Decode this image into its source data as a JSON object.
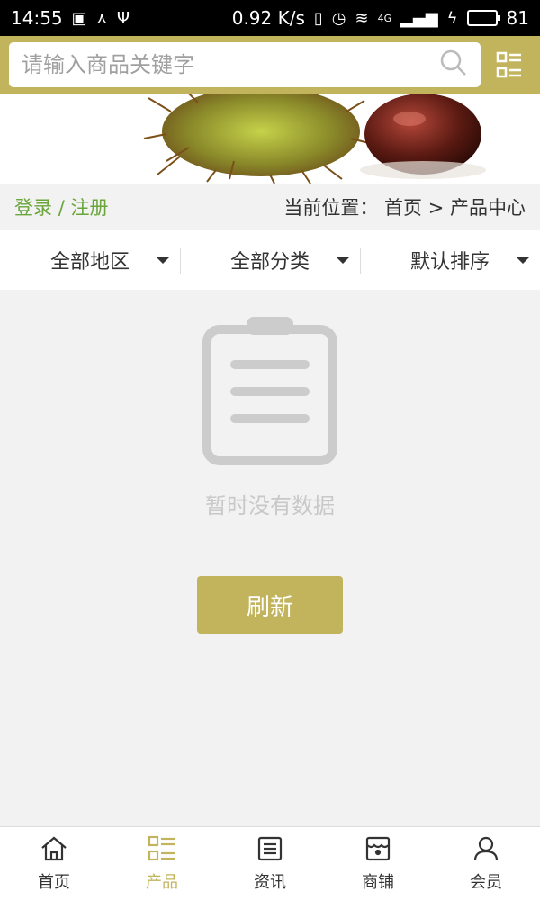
{
  "status": {
    "time": "14:55",
    "speed": "0.92 K/s",
    "network": "4G",
    "battery": "81",
    "battery_level": 0.81,
    "battery_color": "#3fd13f"
  },
  "search": {
    "placeholder": "请输入商品关键字",
    "icon": "search-icon"
  },
  "header": {
    "accent": "#c2b45c",
    "menu_icon": "grid-list-icon"
  },
  "auth": {
    "login": "登录",
    "separator": "/",
    "register": "注册",
    "color": "#6aa63b"
  },
  "breadcrumb": {
    "label": "当前位置：",
    "home": "首页",
    "separator": ">",
    "current": "产品中心"
  },
  "filters": [
    {
      "label": "全部地区",
      "icon": "caret-down-icon"
    },
    {
      "label": "全部分类",
      "icon": "caret-down-icon"
    },
    {
      "label": "默认排序",
      "icon": "caret-down-icon"
    }
  ],
  "empty": {
    "icon": "clipboard-icon",
    "text": "暂时没有数据",
    "button": "刷新"
  },
  "tabs": [
    {
      "label": "首页",
      "icon": "home-icon",
      "active": false
    },
    {
      "label": "产品",
      "icon": "product-list-icon",
      "active": true
    },
    {
      "label": "资讯",
      "icon": "news-icon",
      "active": false
    },
    {
      "label": "商铺",
      "icon": "shop-icon",
      "active": false
    },
    {
      "label": "会员",
      "icon": "user-icon",
      "active": false
    }
  ]
}
